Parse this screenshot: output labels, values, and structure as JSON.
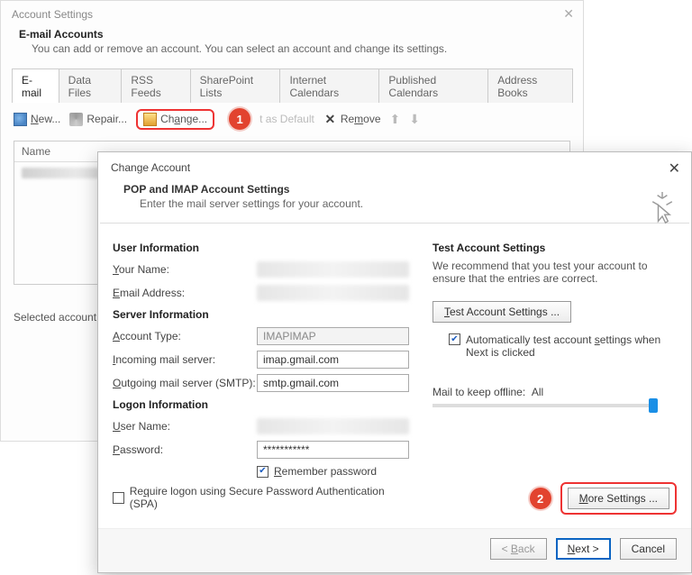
{
  "acct": {
    "title": "Account Settings",
    "head": "E-mail Accounts",
    "sub": "You can add or remove an account. You can select an account and change its settings.",
    "tabs": [
      "E-mail",
      "Data Files",
      "RSS Feeds",
      "SharePoint Lists",
      "Internet Calendars",
      "Published Calendars",
      "Address Books"
    ],
    "tools": {
      "new": "New...",
      "repair": "Repair...",
      "change": "Change...",
      "setdefault": "t as Default",
      "remove": "Remove"
    },
    "list_head": "Name",
    "selected": "Selected account de"
  },
  "chg": {
    "title": "Change Account",
    "pop_h": "POP and IMAP Account Settings",
    "pop_s": "Enter the mail server settings for your account.",
    "user_info": "User Information",
    "your_name": "Your Name:",
    "email": "Email Address:",
    "server_info": "Server Information",
    "account_type": "Account Type:",
    "account_type_val": "IMAP",
    "incoming": "Incoming mail server:",
    "incoming_val": "imap.gmail.com",
    "outgoing": "Outgoing mail server (SMTP):",
    "outgoing_val": "smtp.gmail.com",
    "logon_info": "Logon Information",
    "username": "User Name:",
    "password": "Password:",
    "password_val": "***********",
    "remember": "Remember password",
    "require_spa": "Require logon using Secure Password Authentication (SPA)",
    "test_h": "Test Account Settings",
    "test_p": "We recommend that you test your account to ensure that the entries are correct.",
    "test_btn": "Test Account Settings ...",
    "auto_test": "Automatically test account settings when Next is clicked",
    "mail_keep": "Mail to keep offline:",
    "mail_keep_val": "All",
    "more": "More Settings ...",
    "back": "< Back",
    "next": "Next >",
    "cancel": "Cancel"
  },
  "badges": {
    "one": "1",
    "two": "2"
  }
}
